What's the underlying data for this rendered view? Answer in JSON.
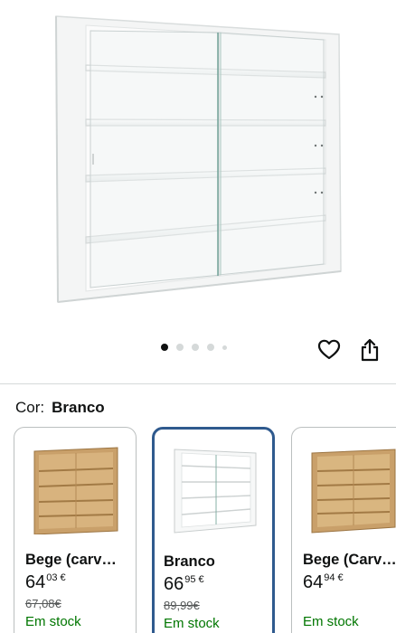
{
  "gallery": {
    "image_count": 5,
    "active_index": 0
  },
  "actions": {
    "favorite_icon": "heart-icon",
    "share_icon": "share-icon"
  },
  "color_selector": {
    "label": "Cor:",
    "selected_value": "Branco"
  },
  "variants": [
    {
      "name": "Bege (carv…",
      "price_whole": "64",
      "price_fraction": "03 €",
      "old_price": "67,08€",
      "stock": "Em stock",
      "finish": "oak"
    },
    {
      "name": "Branco",
      "price_whole": "66",
      "price_fraction": "95 €",
      "old_price": "89,99€",
      "stock": "Em stock",
      "finish": "white"
    },
    {
      "name": "Bege (Carv…",
      "price_whole": "64",
      "price_fraction": "94 €",
      "old_price": "",
      "stock": "Em stock",
      "finish": "oak"
    }
  ],
  "colors": {
    "selected_border": "#2f5a8e",
    "stock_green": "#007600",
    "oak": "#c9a06a",
    "white_cabinet": "#f7f8f8"
  }
}
